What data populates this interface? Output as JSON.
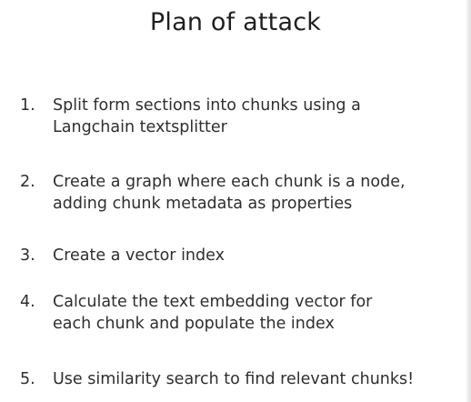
{
  "slide": {
    "title": "Plan of attack",
    "items": [
      {
        "number": "1.",
        "text": "Split form sections into chunks using a\nLangchain textsplitter"
      },
      {
        "number": "2.",
        "text": "Create a graph where each chunk is a node,\nadding chunk metadata as properties"
      },
      {
        "number": "3.",
        "text": "Create a vector index"
      },
      {
        "number": "4.",
        "text": "Calculate the text embedding vector for\neach chunk and populate the index"
      },
      {
        "number": "5.",
        "text": "Use similarity search to find relevant chunks!"
      }
    ]
  }
}
